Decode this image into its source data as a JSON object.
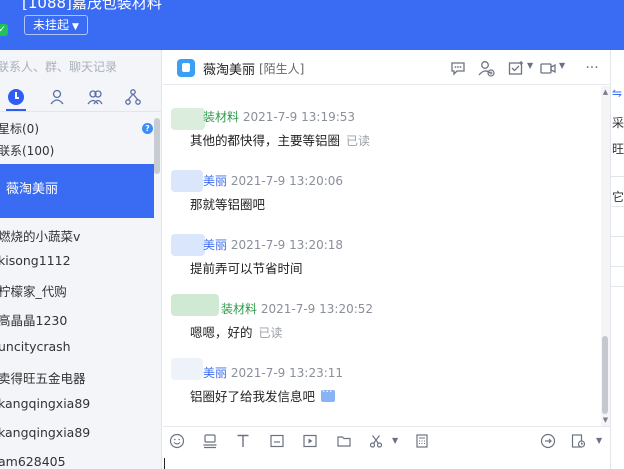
{
  "window": {
    "title": "[1088]嘉茂包装材料",
    "status_label": "未挂起"
  },
  "sidebar": {
    "search_placeholder": "联系人、群、聊天记录",
    "tabs": [
      {
        "icon": "clock-icon"
      },
      {
        "icon": "person-icon"
      },
      {
        "icon": "group-icon"
      },
      {
        "icon": "org-tree-icon"
      }
    ],
    "groups": [
      {
        "label": "星标(0)"
      },
      {
        "label": "联系(100)"
      }
    ],
    "active_contact": "薇淘美丽",
    "contacts": [
      "燃烧的小蔬菜v",
      "kisong1112",
      "柠檬家_代购",
      "高晶晶1230",
      "uncitycrash",
      "卖得旺五金电器",
      "kangqingxia89",
      "kangqingxia89",
      "am628405"
    ]
  },
  "chat": {
    "contact_name": "薇淘美丽",
    "contact_tag": "[陌生人]",
    "header_icons": [
      "chat-bubble-icon",
      "add-contact-icon",
      "task-icon",
      "video-icon",
      "more-icon"
    ],
    "messages": [
      {
        "sender": "装材料",
        "time": "2021-7-9 13:19:53",
        "text": "其他的都快得，主要等铝圈",
        "status": "已读",
        "sender_color": "#2c9a4a"
      },
      {
        "sender": "美丽",
        "time": "2021-7-9 13:20:06",
        "text": "那就等铝圈吧",
        "status": "",
        "sender_color": "#3a6cf3"
      },
      {
        "sender": "美丽",
        "time": "2021-7-9 13:20:18",
        "text": "提前弄可以节省时间",
        "status": "",
        "sender_color": "#3a6cf3"
      },
      {
        "sender": "装材料",
        "time": "2021-7-9 13:20:52",
        "text": "嗯嗯，好的",
        "status": "已读",
        "sender_color": "#2c9a4a"
      },
      {
        "sender": "美丽",
        "time": "2021-7-9 13:23:11",
        "text": "铝圈好了给我发信息吧",
        "status": "",
        "sender_color": "#3a6cf3"
      }
    ]
  },
  "toolbar": {
    "icons": [
      "emoji-icon",
      "stamp-icon",
      "font-icon",
      "screenshot-icon",
      "video-clip-icon",
      "folder-icon",
      "scissors-icon",
      "calculator-icon",
      "quick-reply-icon",
      "history-icon"
    ]
  },
  "right_strip": {
    "glyphs": [
      "采",
      "旺",
      "它"
    ]
  },
  "colors": {
    "brand_blue": "#3a6cf3",
    "seller_green": "#2c9a4a",
    "status_green": "#21c15a"
  }
}
